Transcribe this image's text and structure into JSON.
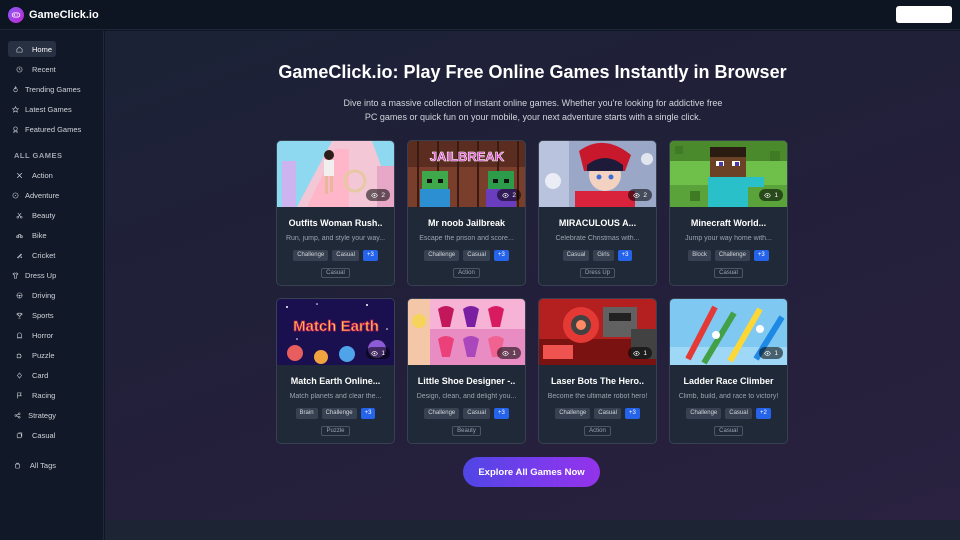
{
  "brand": {
    "name": "GameClick.io",
    "accent": "#8b5cf6"
  },
  "sidebar": {
    "items": [
      {
        "label": "Home",
        "icon": "home-icon"
      },
      {
        "label": "Recent",
        "icon": "clock-icon"
      },
      {
        "label": "Trending Games",
        "icon": "flame-icon"
      },
      {
        "label": "Latest Games",
        "icon": "star-icon"
      },
      {
        "label": "Featured Games",
        "icon": "award-icon"
      }
    ],
    "section_title": "ALL GAMES",
    "categories": [
      {
        "label": "Action",
        "icon": "sword-icon"
      },
      {
        "label": "Adventure",
        "icon": "compass-icon"
      },
      {
        "label": "Beauty",
        "icon": "scissors-icon"
      },
      {
        "label": "Bike",
        "icon": "bike-icon"
      },
      {
        "label": "Cricket",
        "icon": "cricket-icon"
      },
      {
        "label": "Dress Up",
        "icon": "shirt-icon"
      },
      {
        "label": "Driving",
        "icon": "steering-icon"
      },
      {
        "label": "Sports",
        "icon": "trophy-icon"
      },
      {
        "label": "Horror",
        "icon": "ghost-icon"
      },
      {
        "label": "Puzzle",
        "icon": "puzzle-icon"
      },
      {
        "label": "Card",
        "icon": "card-icon"
      },
      {
        "label": "Racing",
        "icon": "flag-icon"
      },
      {
        "label": "Strategy",
        "icon": "strategy-icon"
      },
      {
        "label": "Casual",
        "icon": "casual-icon"
      }
    ],
    "all_tags": {
      "label": "All Tags",
      "icon": "tag-icon"
    }
  },
  "hero": {
    "title": "GameClick.io: Play Free Online Games Instantly in Browser",
    "subtitle": "Dive into a massive collection of instant online games. Whether you're looking for addictive free PC games or quick fun on your mobile, your next adventure starts with a single click."
  },
  "games": [
    {
      "title": "Outfits Woman Rush..",
      "desc": "Run, jump, and style your way...",
      "views": "2",
      "tags": [
        "Challenge",
        "Casual",
        "+3"
      ],
      "category": "Casual"
    },
    {
      "title": "Mr noob Jailbreak",
      "desc": "Escape the prison and score...",
      "views": "2",
      "tags": [
        "Challenge",
        "Casual",
        "+3"
      ],
      "category": "Action"
    },
    {
      "title": "MIRACULOUS A...",
      "desc": "Celebrate Christmas with...",
      "views": "2",
      "tags": [
        "Casual",
        "Girls",
        "+3"
      ],
      "category": "Dress Up"
    },
    {
      "title": "Minecraft World...",
      "desc": "Jump your way home with...",
      "views": "1",
      "tags": [
        "Block",
        "Challenge",
        "+3"
      ],
      "category": "Casual"
    },
    {
      "title": "Match Earth Online...",
      "desc": "Match planets and clear the...",
      "views": "1",
      "tags": [
        "Brain",
        "Challenge",
        "+3"
      ],
      "category": "Puzzle"
    },
    {
      "title": "Little Shoe Designer -..",
      "desc": "Design, clean, and delight you...",
      "views": "1",
      "tags": [
        "Challenge",
        "Casual",
        "+3"
      ],
      "category": "Beauty"
    },
    {
      "title": "Laser Bots The Hero..",
      "desc": "Become the ultimate robot hero!",
      "views": "1",
      "tags": [
        "Challenge",
        "Casual",
        "+3"
      ],
      "category": "Action"
    },
    {
      "title": "Ladder Race Climber",
      "desc": "Climb, build, and race to victory!",
      "views": "1",
      "tags": [
        "Challenge",
        "Casual",
        "+2"
      ],
      "category": "Casual"
    }
  ],
  "thumb_texts": {
    "jailbreak": "JAILBREAK",
    "match_earth": "Match Earth"
  },
  "cta": {
    "label": "Explore All Games Now"
  }
}
